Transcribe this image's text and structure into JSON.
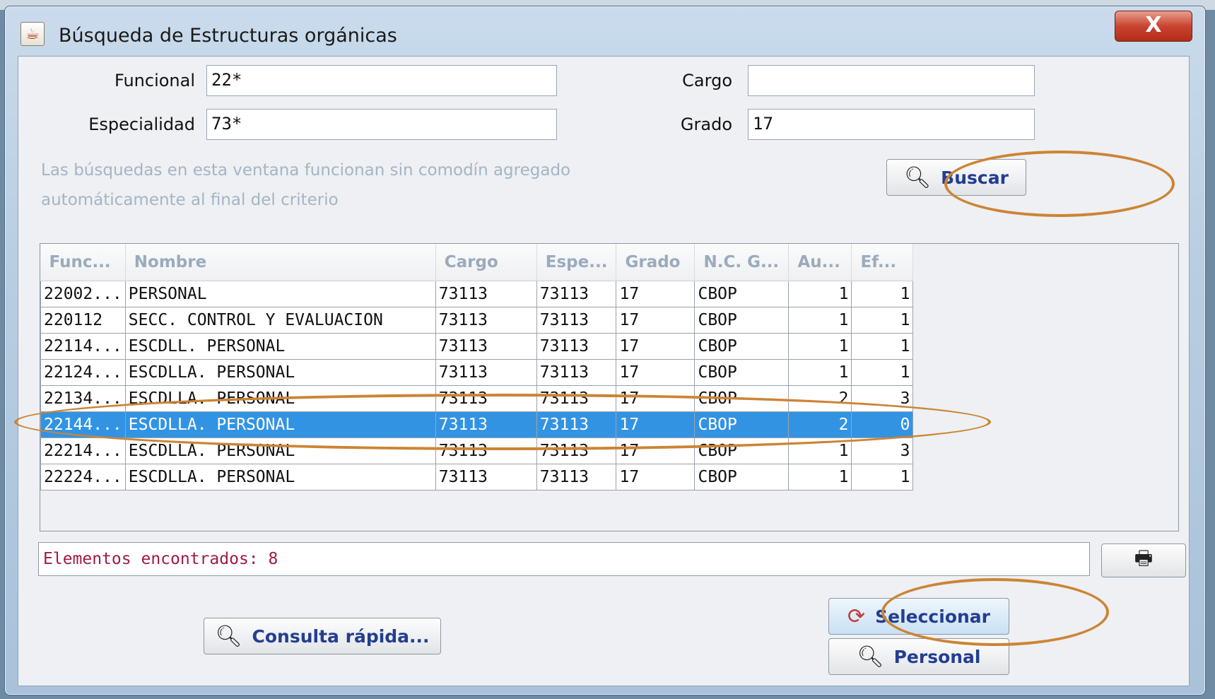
{
  "window": {
    "title": "Búsqueda de Estructuras orgánicas",
    "close_label": "X"
  },
  "icons": {
    "app": "java-icon",
    "close": "close-icon",
    "search": "magnifier-icon",
    "print": "printer-icon",
    "select": "refresh-icon"
  },
  "form": {
    "funcional": {
      "label": "Funcional",
      "value": "22*"
    },
    "especialidad": {
      "label": "Especialidad",
      "value": "73*"
    },
    "cargo": {
      "label": "Cargo",
      "value": ""
    },
    "grado": {
      "label": "Grado",
      "value": "17"
    }
  },
  "hint": {
    "line1": "Las búsquedas en esta ventana funcionan sin comodín agregado",
    "line2": "automáticamente al final del criterio"
  },
  "buttons": {
    "buscar": "Buscar",
    "consulta": "Consulta rápida...",
    "seleccionar": "Seleccionar",
    "personal": "Personal"
  },
  "table": {
    "headers": [
      "Func...",
      "Nombre",
      "Cargo",
      "Espe...",
      "Grado",
      "N.C. G...",
      "Au...",
      "Ef..."
    ],
    "rows": [
      [
        "22002...",
        "PERSONAL",
        "73113",
        "73113",
        "17",
        "CBOP",
        "1",
        "1"
      ],
      [
        "220112",
        "SECC. CONTROL Y EVALUACION",
        "73113",
        "73113",
        "17",
        "CBOP",
        "1",
        "1"
      ],
      [
        "22114...",
        "ESCDLL. PERSONAL",
        "73113",
        "73113",
        "17",
        "CBOP",
        "1",
        "1"
      ],
      [
        "22124...",
        "ESCDLLA. PERSONAL",
        "73113",
        "73113",
        "17",
        "CBOP",
        "1",
        "1"
      ],
      [
        "22134...",
        "ESCDLLA. PERSONAL",
        "73113",
        "73113",
        "17",
        "CBOP",
        "2",
        "3"
      ],
      [
        "22144...",
        "ESCDLLA. PERSONAL",
        "73113",
        "73113",
        "17",
        "CBOP",
        "2",
        "0"
      ],
      [
        "22214...",
        "ESCDLLA. PERSONAL",
        "73113",
        "73113",
        "17",
        "CBOP",
        "1",
        "3"
      ],
      [
        "22224...",
        "ESCDLLA. PERSONAL",
        "73113",
        "73113",
        "17",
        "CBOP",
        "1",
        "1"
      ]
    ],
    "selected_row": 5
  },
  "status": {
    "text": "Elementos encontrados: 8"
  },
  "colors": {
    "selection": "#3393e3",
    "annotation": "#cc8434",
    "status_text": "#a01a46",
    "button_text": "#233e91"
  }
}
